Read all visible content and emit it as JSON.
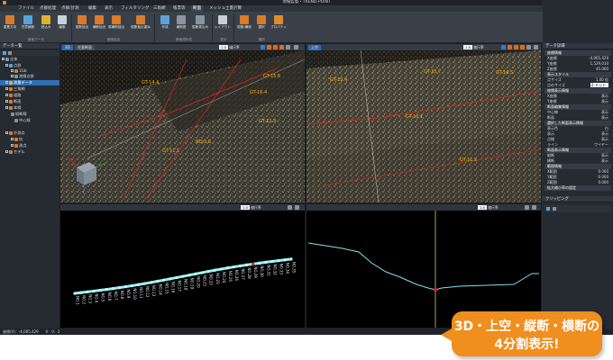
{
  "titlebar": {
    "title": "現場監督・TREND-POINT",
    "minimize": "–",
    "maximize": "□",
    "close": "✕"
  },
  "menu": {
    "items": [
      {
        "label": "ファイル"
      },
      {
        "label": "点群処理"
      },
      {
        "label": "点群/計測"
      },
      {
        "label": "編集"
      },
      {
        "label": "表示"
      },
      {
        "label": "フィルタリング"
      },
      {
        "label": "三角網"
      },
      {
        "label": "帳票等"
      },
      {
        "label": "断面"
      },
      {
        "label": "メッシュ土量計算"
      }
    ],
    "active_index": 8,
    "user": "比較プロジェクト"
  },
  "ribbon": {
    "buttons": [
      {
        "label": "重畳方向",
        "color": "#d97b2a"
      },
      {
        "label": "任意横断",
        "color": "#5aa3da"
      },
      {
        "label": "読込み",
        "color": "#e0b030"
      },
      {
        "label": "編集",
        "color": "#c8d0da"
      },
      {
        "label": "縦断抽出",
        "color": "#d97b2a"
      },
      {
        "label": "横断抽出",
        "color": "#d97b2a"
      },
      {
        "label": "縦横断抽出",
        "color": "#d97b2a"
      },
      {
        "label": "縦断抽出重ね",
        "color": "#d97b2a"
      },
      {
        "label": "作成",
        "color": "#5aa3da"
      },
      {
        "label": "横断図",
        "color": "#8a949f"
      },
      {
        "label": "縦断書込み",
        "color": "#8a949f"
      },
      {
        "label": "レイアウト",
        "color": "#c8d0da"
      },
      {
        "label": "縦断/横面",
        "color": "#d97b2a"
      },
      {
        "label": "選択",
        "color": "#d97b2a"
      },
      {
        "label": "プロパティ",
        "color": "#e08a2c"
      }
    ],
    "groups": [
      {
        "label": "断面データ"
      },
      {
        "label": "断面抽出"
      },
      {
        "label": "断面図作成"
      },
      {
        "label": "表示"
      },
      {
        "label": "選択"
      }
    ]
  },
  "left_panel": {
    "title": "データ一覧",
    "rows": [
      {
        "label": "全体"
      },
      {
        "label": "点群"
      },
      {
        "label": "1Gb"
      },
      {
        "label": "測線点群"
      },
      {
        "label": "測量データ"
      },
      {
        "label": "三角網"
      },
      {
        "label": "道路"
      },
      {
        "label": "断面"
      },
      {
        "label": "本線"
      },
      {
        "label": "縦断線"
      },
      {
        "label": "中心線"
      },
      {
        "label": "計測点"
      },
      {
        "label": "杭"
      },
      {
        "label": "測点"
      },
      {
        "label": "モデル"
      }
    ],
    "selected_index": 4
  },
  "views": {
    "v3d": {
      "tabs": [
        "3D",
        "任意断面"
      ],
      "zoom_label": "縮尺率",
      "zoom_value": "1.0",
      "labels": [
        "GT-14.4",
        "GT-15.6",
        "GT-12.3",
        "GT-11.1",
        "GT-16.4",
        "NO.9.8"
      ]
    },
    "vtop": {
      "tabs": [
        "上空"
      ],
      "zoom_label": "縮尺率",
      "zoom_value": "1.0",
      "labels": [
        "GT-12.4",
        "GT-15.7",
        "GT-13.1",
        "GT-11.5",
        "GT-16.5"
      ]
    },
    "vlong": {
      "zoom_label": "縮尺率",
      "zoom_value": "1.0",
      "banner": "中心線（横断番号：NO.29）",
      "stations": [
        "NO.1",
        "NO.2",
        "NO.3",
        "NO.4",
        "NO.5",
        "NO.6",
        "NO.7",
        "NO.8",
        "NO.9",
        "NO.10",
        "NO.11",
        "NO.12",
        "NO.13",
        "NO.14",
        "NO.15",
        "NO.16",
        "NO.17",
        "NO.18",
        "NO.19",
        "NO.20",
        "NO.21",
        "NO.22",
        "NO.23",
        "NO.24",
        "NO.25",
        "NO.26",
        "NO.27",
        "NO.28",
        "NO.29",
        "NO.30",
        "NO.31",
        "NO.32",
        "NO.33",
        "NO.34",
        "NO.35"
      ]
    },
    "vcross": {
      "zoom_label": "縮尺率",
      "zoom_value": "1.0",
      "banner": "NO.29（横断番号：NO.29）"
    }
  },
  "right_panel": {
    "title": "データ詳細",
    "rows": [
      {
        "type": "sec",
        "key": "座標情報"
      },
      {
        "type": "kv",
        "key": "X座標",
        "value": "-4,065,429"
      },
      {
        "type": "kv",
        "key": "Y座標",
        "value": "1,529,010"
      },
      {
        "type": "kv",
        "key": "Z座標",
        "value": "45.000"
      },
      {
        "type": "sec",
        "key": "表示スタイル"
      },
      {
        "type": "kv",
        "key": "点サイズ",
        "value": "1.00 倍"
      },
      {
        "type": "input",
        "key": "点のサイズ",
        "value": "2 ドット"
      },
      {
        "type": "sec",
        "key": "座標表示情報"
      },
      {
        "type": "kv",
        "key": "X座標",
        "value": "表示"
      },
      {
        "type": "kv",
        "key": "Y座標",
        "value": "表示"
      },
      {
        "type": "sec",
        "key": "断面編集情報"
      },
      {
        "type": "kv",
        "key": "中心線",
        "value": "表示"
      },
      {
        "type": "kv",
        "key": "断面",
        "value": "表示"
      },
      {
        "type": "sec",
        "key": "選択した断面表示情報"
      },
      {
        "type": "kv",
        "key": "表示色",
        "value": "白"
      },
      {
        "type": "kv",
        "key": "表示",
        "value": "表示"
      },
      {
        "type": "kv",
        "key": "点線",
        "value": "表示"
      },
      {
        "type": "kv",
        "key": "ライン",
        "value": "ワイヤー"
      },
      {
        "type": "sec",
        "key": "断面表示情報"
      },
      {
        "type": "kv",
        "key": "縦断",
        "value": "表示"
      },
      {
        "type": "kv",
        "key": "横断",
        "value": "表示"
      },
      {
        "type": "sec",
        "key": "範囲情報"
      },
      {
        "type": "kv",
        "key": "X範囲",
        "value": "0.000"
      },
      {
        "type": "kv",
        "key": "Y範囲",
        "value": "0.000"
      },
      {
        "type": "kv",
        "key": "Z範囲",
        "value": "0.000"
      },
      {
        "type": "sec",
        "key": "拡大縮小率の設定"
      }
    ],
    "palette_title": "クリッピング"
  },
  "statusbar": {
    "text": "座標(X)：-4,065,429　　0：0：2"
  },
  "callout": {
    "line1": "3D・上空・縦断・横断の",
    "line2": "4分割表示!"
  },
  "colors": {
    "accent_orange": "#f08e1e",
    "selection_blue": "#2f6db6",
    "line_cyan": "#7fe3ef",
    "section_red": "#e02020"
  }
}
